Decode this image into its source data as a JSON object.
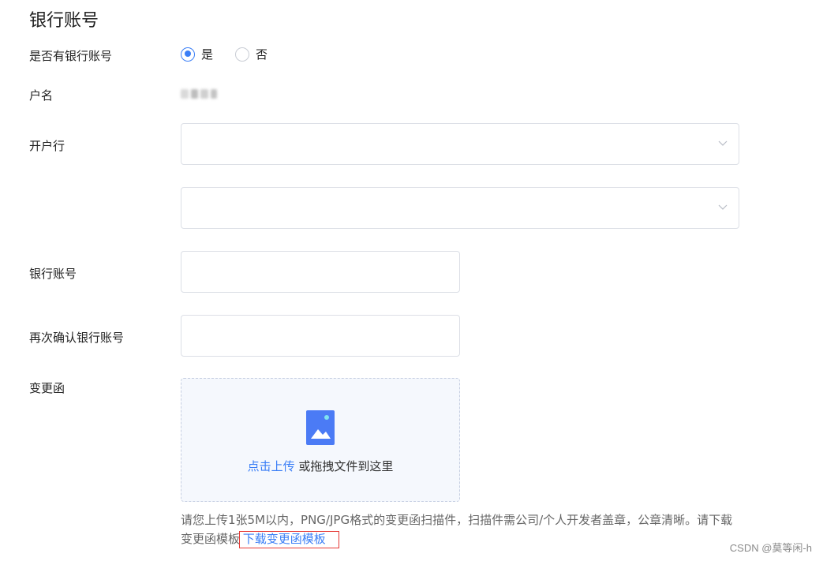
{
  "section_title": "银行账号",
  "fields": {
    "has_account": {
      "label": "是否有银行账号",
      "options": [
        {
          "label": "是",
          "checked": true
        },
        {
          "label": "否",
          "checked": false
        }
      ]
    },
    "account_name": {
      "label": "户名"
    },
    "bank": {
      "label": "开户行"
    },
    "account_number": {
      "label": "银行账号"
    },
    "confirm_account_number": {
      "label": "再次确认银行账号"
    },
    "change_letter": {
      "label": "变更函"
    }
  },
  "upload": {
    "link_text": "点击上传",
    "rest_text": " 或拖拽文件到这里",
    "icon": "image-upload-icon"
  },
  "hint": {
    "text": "请您上传1张5M以内，PNG/JPG格式的变更函扫描件，扫描件需公司/个人开发者盖章，公章清晰。请下载变更函模板 ",
    "download_link": "下载变更函模板"
  },
  "watermark": "CSDN @莫等闲-h",
  "colors": {
    "accent": "#3a7ef6",
    "highlight_box": "#e53935",
    "upload_bg": "#f5f8fd"
  }
}
